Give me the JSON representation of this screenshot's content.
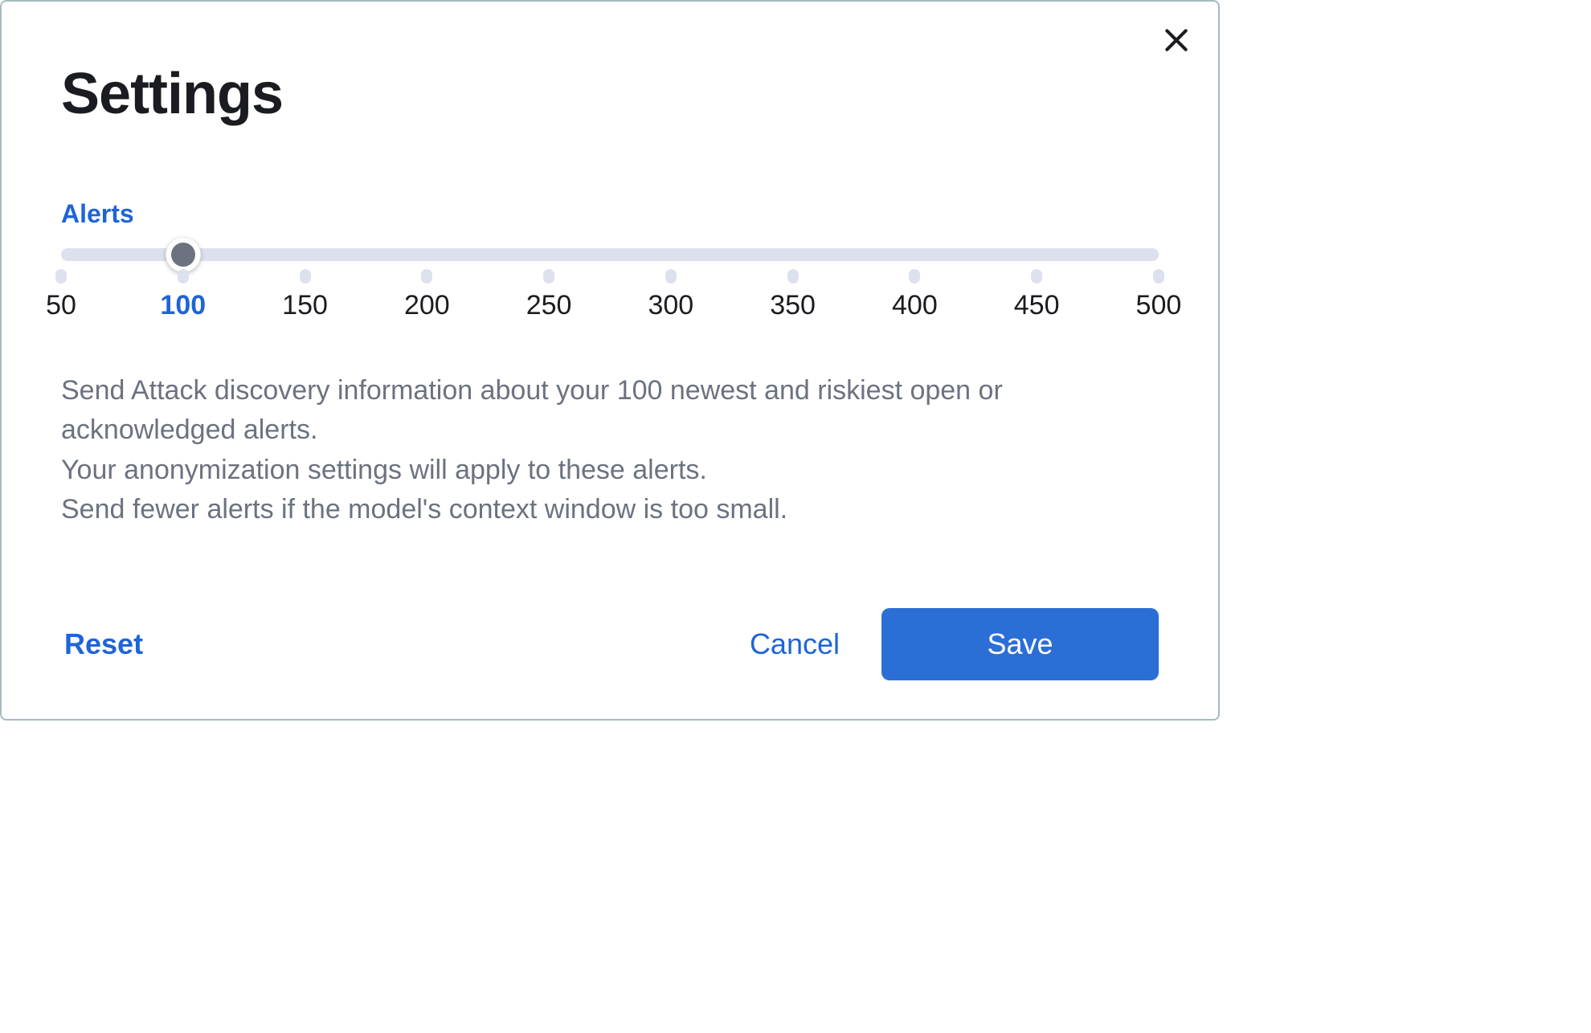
{
  "modal": {
    "title": "Settings",
    "close_icon": "close-icon"
  },
  "slider": {
    "label": "Alerts",
    "min": 50,
    "max": 500,
    "step": 50,
    "value": 100,
    "ticks": [
      {
        "value": 50,
        "label": "50"
      },
      {
        "value": 100,
        "label": "100"
      },
      {
        "value": 150,
        "label": "150"
      },
      {
        "value": 200,
        "label": "200"
      },
      {
        "value": 250,
        "label": "250"
      },
      {
        "value": 300,
        "label": "300"
      },
      {
        "value": 350,
        "label": "350"
      },
      {
        "value": 400,
        "label": "400"
      },
      {
        "value": 450,
        "label": "450"
      },
      {
        "value": 500,
        "label": "500"
      }
    ]
  },
  "description": {
    "line1": "Send Attack discovery information about your 100 newest and riskiest open or acknowledged alerts.",
    "line2": "Your anonymization settings will apply to these alerts.",
    "line3": "Send fewer alerts if the model's context window is too small."
  },
  "footer": {
    "reset_label": "Reset",
    "cancel_label": "Cancel",
    "save_label": "Save"
  },
  "colors": {
    "accent": "#1f64d8",
    "primary_button": "#2b6fd6",
    "track": "#dde1ee",
    "thumb_inner": "#6c727f",
    "text_muted": "#6b7280",
    "text": "#1a1c21"
  }
}
